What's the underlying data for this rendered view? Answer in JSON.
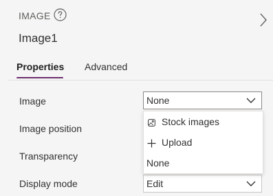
{
  "header": {
    "type_label": "IMAGE",
    "help_icon": "help-circle-icon",
    "collapse_icon": "chevron-right-icon",
    "control_name": "Image1"
  },
  "tabs": [
    {
      "label": "Properties",
      "active": true
    },
    {
      "label": "Advanced",
      "active": false
    }
  ],
  "properties": {
    "image": {
      "label": "Image",
      "value": "None"
    },
    "image_position": {
      "label": "Image position"
    },
    "transparency": {
      "label": "Transparency"
    },
    "display_mode": {
      "label": "Display mode",
      "value": "Edit"
    }
  },
  "image_menu": {
    "items": [
      {
        "label": "Stock images",
        "icon": "image-icon"
      },
      {
        "label": "Upload",
        "icon": "plus-icon"
      },
      {
        "label": "None"
      }
    ]
  },
  "colors": {
    "accent": "#6b2b6f",
    "panel_bg": "#f5f5f5",
    "text": "#323130"
  }
}
